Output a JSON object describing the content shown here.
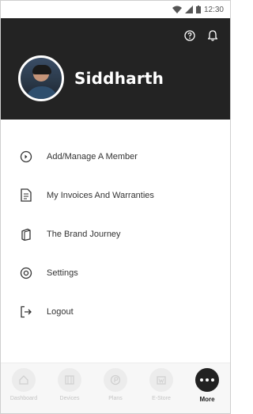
{
  "status_bar": {
    "time": "12:30",
    "icons": [
      "wifi-icon",
      "signal-icon",
      "battery-icon"
    ]
  },
  "header": {
    "user_name": "Siddharth",
    "icons": [
      "help-icon",
      "bell-icon"
    ],
    "background": "#232323"
  },
  "menu": {
    "items": [
      {
        "label": "Add/Manage A Member",
        "icon": "add-member-icon"
      },
      {
        "label": "My Invoices And Warranties",
        "icon": "invoice-icon"
      },
      {
        "label": "The Brand Journey",
        "icon": "book-icon"
      },
      {
        "label": "Settings",
        "icon": "settings-icon"
      },
      {
        "label": "Logout",
        "icon": "logout-icon"
      }
    ]
  },
  "bottom_nav": {
    "items": [
      {
        "label": "Dashboard",
        "icon": "dashboard-icon"
      },
      {
        "label": "Devices",
        "icon": "devices-icon"
      },
      {
        "label": "Plans",
        "icon": "plans-icon"
      },
      {
        "label": "E-Store",
        "icon": "estore-icon"
      },
      {
        "label": "More",
        "icon": "more-icon",
        "active": true
      }
    ]
  },
  "colors": {
    "header_bg": "#232323",
    "active_nav": "#222222",
    "inactive_nav": "#c4c4c4"
  }
}
